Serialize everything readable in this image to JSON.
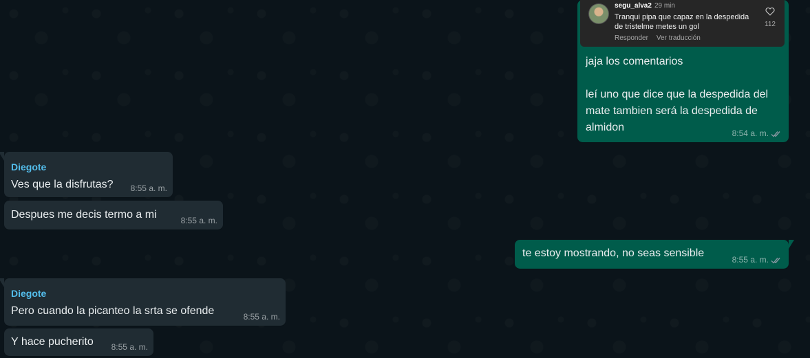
{
  "messages": {
    "m1": {
      "screenshot": {
        "username": "segu_alva2",
        "time_ago": "29 min",
        "comment": "Tranqui pipa que capaz en la despedida de tristelme metes un gol",
        "reply_label": "Responder",
        "translate_label": "Ver traducción",
        "likes": "112"
      },
      "text": "jaja los comentarios\n\nleí uno que dice que la despedida del mate tambien será la despedida de almidon",
      "time": "8:54 a. m."
    },
    "m2": {
      "sender": "Diegote",
      "text": "Ves que la disfrutas?",
      "time": "8:55 a. m."
    },
    "m3": {
      "text": "Despues me decis termo a mi",
      "time": "8:55 a. m."
    },
    "m4": {
      "text": "te estoy mostrando, no seas sensible",
      "time": "8:55 a. m."
    },
    "m5": {
      "sender": "Diegote",
      "text": "Pero cuando la picanteo la srta se ofende",
      "time": "8:55 a. m."
    },
    "m6": {
      "text": "Y hace pucherito",
      "time": "8:55 a. m."
    }
  },
  "colors": {
    "background": "#0b141a",
    "incoming_bubble": "#202c33",
    "outgoing_bubble": "#005c4b",
    "sender_name": "#53bdeb",
    "read_ticks": "#8696a0"
  },
  "icons": [
    "double-check-icon",
    "heart-icon",
    "avatar"
  ]
}
